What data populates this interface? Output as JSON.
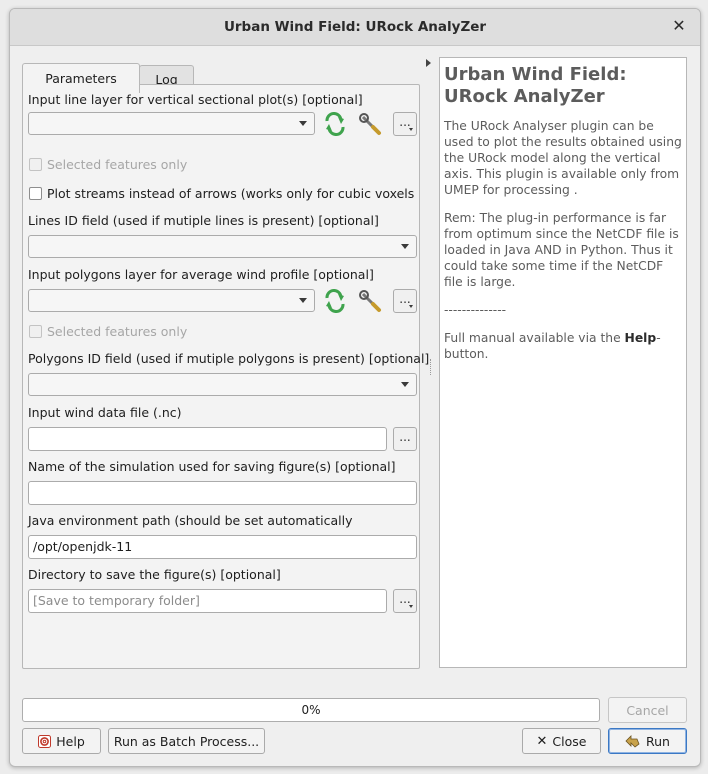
{
  "window": {
    "title": "Urban Wind Field: URock AnalyZer"
  },
  "tabs": [
    {
      "label": "Parameters"
    },
    {
      "label": "Log"
    }
  ],
  "params": {
    "line_layer_label": "Input line layer for vertical sectional plot(s) [optional]",
    "line_layer_value": "",
    "selected_only_1": "Selected features only",
    "plot_streams": "Plot streams instead of arrows (works only for cubic voxels",
    "lines_id_label": "Lines ID field (used if mutiple lines is present) [optional]",
    "poly_layer_label": "Input polygons layer for average wind profile [optional]",
    "selected_only_2": "Selected features only",
    "poly_id_label": "Polygons ID field (used if mutiple polygons is present) [optional]",
    "wind_file_label": "Input wind data file (.nc)",
    "wind_file_value": "",
    "sim_name_label": "Name of the simulation used for saving figure(s) [optional]",
    "sim_name_value": "",
    "java_label": "Java environment path (should be set automatically",
    "java_value": "/opt/openjdk-11",
    "dir_label": "Directory to save the figure(s) [optional]",
    "dir_placeholder": "[Save to temporary folder]",
    "browse": "..."
  },
  "help": {
    "title": "Urban Wind Field: URock AnalyZer",
    "p1": "The URock Analyser plugin can be used to plot the results obtained using the URock model along the vertical axis. This plugin is available only from UMEP for processing .",
    "p2": "Rem: The plug-in performance is far from optimum since the NetCDF file is loaded in Java AND in Python. Thus it could take some time if the NetCDF file is large.",
    "sep": "--------------",
    "p3_pre": "Full manual available via the ",
    "p3_bold": "Help",
    "p3_post": "-button."
  },
  "progress": {
    "text": "0%",
    "value": 0
  },
  "buttons": {
    "cancel": "Cancel",
    "help": "Help",
    "batch": "Run as Batch Process...",
    "close": "Close",
    "run": "Run"
  },
  "colors": {
    "accent_green": "#3fa34d",
    "default_border": "#3b78c4"
  }
}
